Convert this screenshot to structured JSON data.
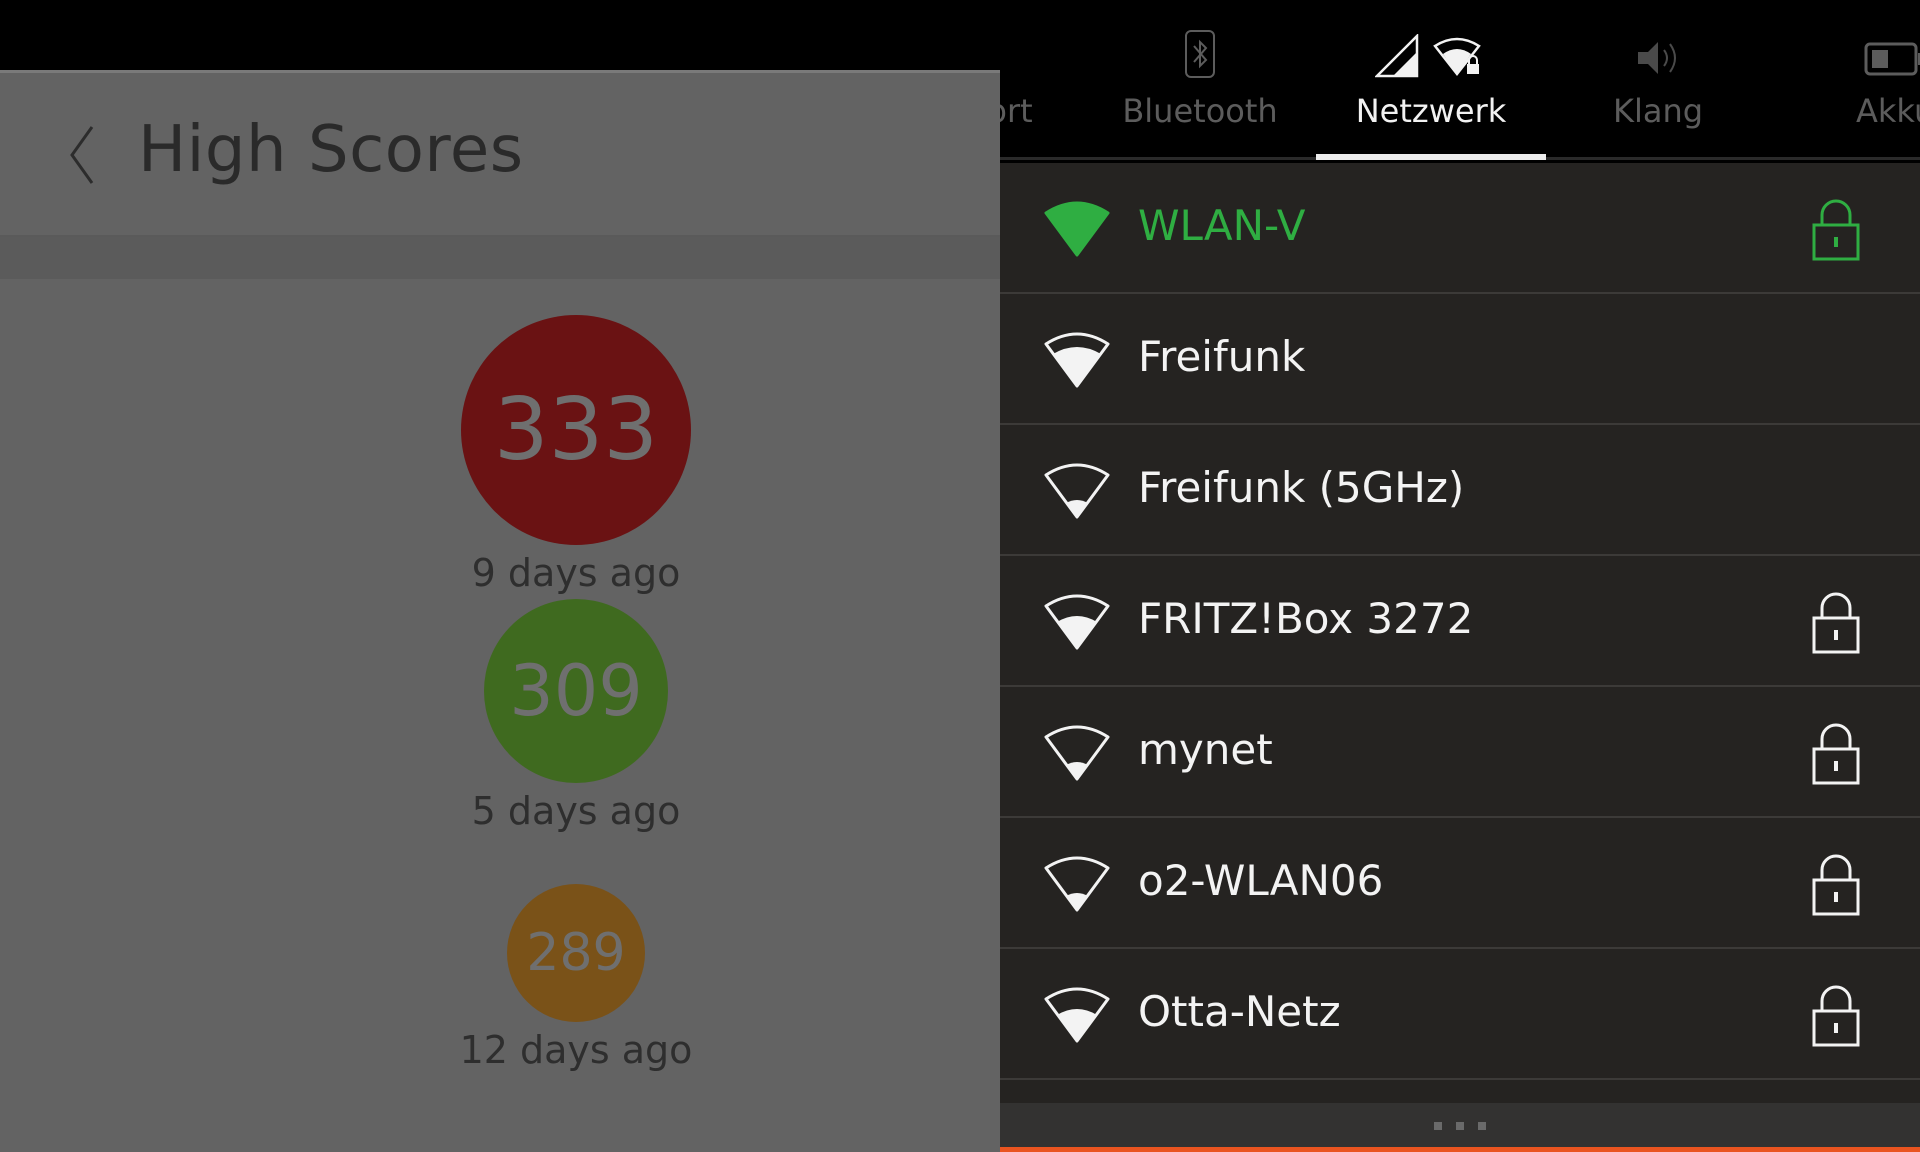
{
  "app": {
    "title": "High Scores",
    "scores": [
      {
        "value": "333",
        "ago": "9 days ago",
        "color": "#6a1213"
      },
      {
        "value": "309",
        "ago": "5 days ago",
        "color": "#3f6a1f"
      },
      {
        "value": "289",
        "ago": "12 days ago",
        "color": "#7a5218"
      }
    ]
  },
  "indicators": {
    "tabs": [
      {
        "label": "ort",
        "icon": "location-icon"
      },
      {
        "label": "Bluetooth",
        "icon": "bluetooth-icon"
      },
      {
        "label": "Netzwerk",
        "icon": "network-signal-wifi-icon",
        "active": true
      },
      {
        "label": "Klang",
        "icon": "speaker-icon"
      },
      {
        "label": "Akku",
        "icon": "battery-icon"
      }
    ]
  },
  "networks": [
    {
      "name": "WLAN-V",
      "connected": true,
      "secured": true,
      "signal": "full"
    },
    {
      "name": "Freifunk",
      "connected": false,
      "secured": false,
      "signal": "high"
    },
    {
      "name": "Freifunk (5GHz)",
      "connected": false,
      "secured": false,
      "signal": "low"
    },
    {
      "name": "FRITZ!Box 3272",
      "connected": false,
      "secured": true,
      "signal": "high"
    },
    {
      "name": "mynet",
      "connected": false,
      "secured": true,
      "signal": "low"
    },
    {
      "name": "o2-WLAN06",
      "connected": false,
      "secured": true,
      "signal": "low"
    },
    {
      "name": "Otta-Netz",
      "connected": false,
      "secured": true,
      "signal": "high"
    }
  ],
  "colors": {
    "connected": "#2fae42",
    "accent": "#e95420"
  }
}
